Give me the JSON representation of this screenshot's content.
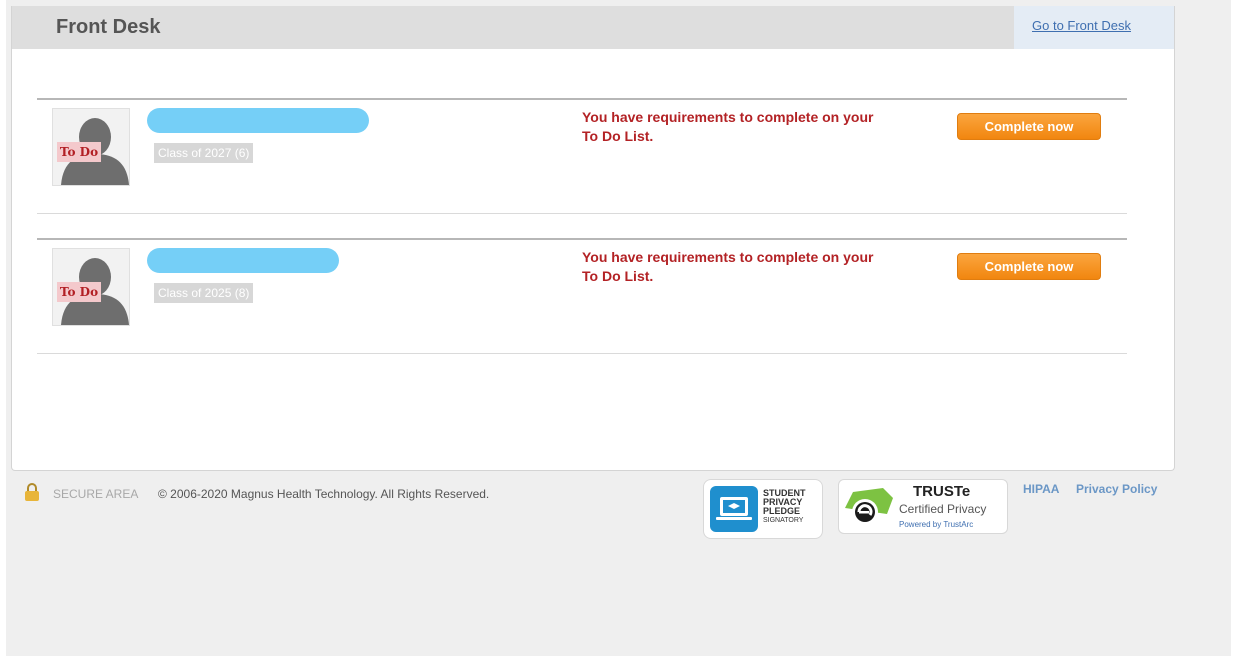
{
  "header": {
    "title": "Front Desk",
    "link_label": "Go to Front Desk"
  },
  "students": [
    {
      "badge": "To Do",
      "class_label": "Class of 2027 (6)",
      "message": "You have requirements to complete on your To Do List.",
      "button_label": "Complete now"
    },
    {
      "badge": "To Do",
      "class_label": "Class of 2025 (8)",
      "message": "You have requirements to complete on your To Do List.",
      "button_label": "Complete now"
    }
  ],
  "footer": {
    "secure_label": "SECURE AREA",
    "copyright": "© 2006-2020 Magnus Health Technology. All Rights Reserved.",
    "spp_badge": {
      "line1": "STUDENT",
      "line2": "PRIVACY",
      "line3": "PLEDGE",
      "line4": "SIGNATORY"
    },
    "truste_badge": {
      "title": "TRUSTe",
      "subtitle": "Certified Privacy",
      "powered": "Powered by TrustArc"
    },
    "links": [
      "HIPAA",
      "Privacy Policy"
    ]
  },
  "colors": {
    "accent_button": "#f1860f",
    "alert_text": "#b32225",
    "link": "#3f6fb0",
    "redaction": "#75cff7"
  }
}
